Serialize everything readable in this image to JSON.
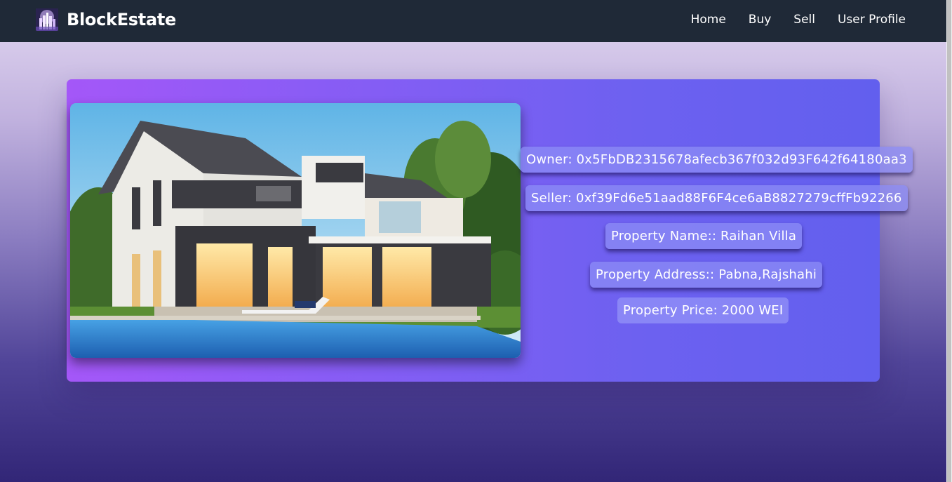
{
  "navbar": {
    "brand": "BlockEstate",
    "links": [
      "Home",
      "Buy",
      "Sell",
      "User Profile"
    ]
  },
  "property": {
    "owner": "Owner: 0x5FbDB2315678afecb367f032d93F642f64180aa3",
    "seller": "Seller: 0xf39Fd6e51aad88F6F4ce6aB8827279cffFb92266",
    "name": "Property Name:: Raihan Villa",
    "address": "Property Address:: Pabna,Rajshahi",
    "price": "Property Price: 2000 WEI"
  },
  "colors": {
    "navbar_bg": "#1f2937",
    "card_gradient_start": "#a457f8",
    "card_gradient_end": "#625fee"
  }
}
